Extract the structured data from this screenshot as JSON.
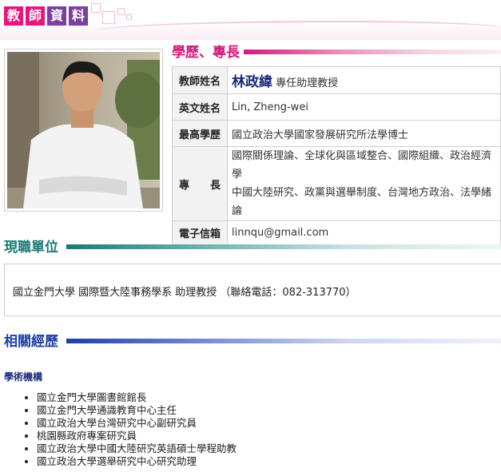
{
  "header": {
    "title_chars": [
      "教",
      "師",
      "資",
      "料"
    ],
    "title_colors": [
      "#e6177c",
      "#e6177c",
      "#7b3fa0",
      "#7b3fa0"
    ]
  },
  "education_section": {
    "title": "學歷、專長",
    "color": "#d21b7c"
  },
  "profile": {
    "name_label": "教師姓名",
    "name": "林政緯",
    "rank": "專任助理教授",
    "english_name_label": "英文姓名",
    "english_name": "Lin, Zheng-wei",
    "degree_label": "最高學歷",
    "degree": "國立政治大學國家發展研究所法學博士",
    "specialty_label": "專　　長",
    "specialty_line1": "國際關係理論、全球化與區域整合、國際組織、政治經濟學",
    "specialty_line2": "中國大陸研究、政黨與選舉制度、台灣地方政治、法學緒論",
    "email_label": "電子信箱",
    "email": "linnqu@gmail.com"
  },
  "current_unit": {
    "title": "現職單位",
    "color": "#1a7a78",
    "text": "國立金門大學  國際暨大陸事務學系  助理教授 （聯絡電話：082-313770）"
  },
  "experience": {
    "title": "相關經歷",
    "color": "#1e3fa6",
    "category": "學術機構",
    "items": [
      "國立金門大學圖書館館長",
      "國立金門大學通識教育中心主任",
      "國立政治大學台灣研究中心副研究員",
      "桃園縣政府專案研究員",
      "國立政治大學中國大陸研究英語碩士學程助教",
      "國立政治大學選舉研究中心研究助理"
    ]
  }
}
